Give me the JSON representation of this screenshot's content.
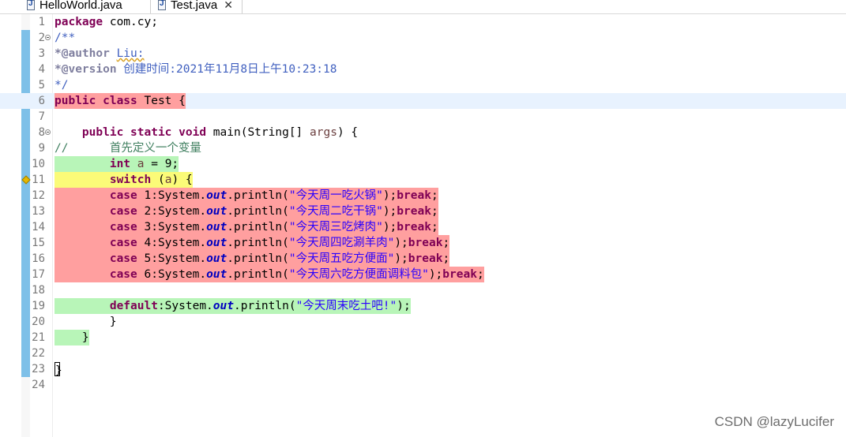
{
  "tabs": [
    {
      "label": "HelloWorld.java",
      "icon": "java-file-icon",
      "active": false
    },
    {
      "label": "Test.java",
      "icon": "java-file-icon",
      "active": true,
      "close": "✕"
    }
  ],
  "editor": {
    "line_numbers": [
      "1",
      "2",
      "3",
      "4",
      "5",
      "6",
      "7",
      "8",
      "9",
      "10",
      "11",
      "12",
      "13",
      "14",
      "15",
      "16",
      "17",
      "18",
      "19",
      "20",
      "21",
      "22",
      "23",
      "24"
    ],
    "line1": {
      "kw": "package",
      "rest": " com.cy;"
    },
    "line2": "/**",
    "line3": {
      "tag": "*@author",
      "sp": " ",
      "name": "Liu:"
    },
    "line4": {
      "tag": "*@version",
      "text": " 创建时间:2021年11月8日上午10:23:18"
    },
    "line5": "*/",
    "line6": {
      "kw": "public class",
      "rest": " Test {"
    },
    "line8": {
      "indent": "    ",
      "kw": "public static void",
      "rest": " main(String[] ",
      "var": "args",
      "end": ") {"
    },
    "line9": "//      首先定义一个变量",
    "line10": {
      "indent": "        ",
      "kw": "int",
      "sp": " ",
      "var": "a",
      "rest": " = 9;"
    },
    "line11": {
      "indent": "        ",
      "kw": "switch",
      "sp": " (",
      "var": "a",
      "rest": ") {"
    },
    "cases": [
      {
        "kw": "case",
        "num": " 1:System.",
        "fld": "out",
        "mid": ".println(",
        "str": "\"今天周一吃火锅\"",
        "end": ");",
        "brk": "break",
        "semi": ";"
      },
      {
        "kw": "case",
        "num": " 2:System.",
        "fld": "out",
        "mid": ".println(",
        "str": "\"今天周二吃干锅\"",
        "end": ");",
        "brk": "break",
        "semi": ";"
      },
      {
        "kw": "case",
        "num": " 3:System.",
        "fld": "out",
        "mid": ".println(",
        "str": "\"今天周三吃烤肉\"",
        "end": ");",
        "brk": "break",
        "semi": ";"
      },
      {
        "kw": "case",
        "num": " 4:System.",
        "fld": "out",
        "mid": ".println(",
        "str": "\"今天周四吃涮羊肉\"",
        "end": ");",
        "brk": "break",
        "semi": ";"
      },
      {
        "kw": "case",
        "num": " 5:System.",
        "fld": "out",
        "mid": ".println(",
        "str": "\"今天周五吃方便面\"",
        "end": ");",
        "brk": "break",
        "semi": ";"
      },
      {
        "kw": "case",
        "num": " 6:System.",
        "fld": "out",
        "mid": ".println(",
        "str": "\"今天周六吃方便面调料包\"",
        "end": ");",
        "brk": "break",
        "semi": ";"
      }
    ],
    "line19": {
      "indent": "        ",
      "kw": "default",
      "num": ":System.",
      "fld": "out",
      "mid": ".println(",
      "str": "\"今天周末吃土吧!\"",
      "end": ");"
    },
    "line20": "        }",
    "line21": {
      "indent": "    ",
      "text": "}"
    },
    "line23": "}"
  },
  "colors": {
    "uncovered": "#ff9f9f",
    "covered": "#b8f5b8",
    "partial": "#fbfb78"
  },
  "watermark": "CSDN @lazyLucifer"
}
